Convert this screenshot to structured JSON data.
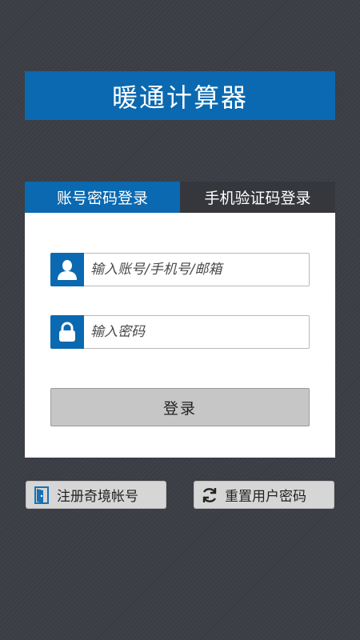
{
  "app": {
    "title": "暖通计算器"
  },
  "tabs": [
    {
      "label": "账号密码登录",
      "active": true
    },
    {
      "label": "手机验证码登录",
      "active": false
    }
  ],
  "login_form": {
    "account_placeholder": "输入账号/手机号/邮箱",
    "account_value": "",
    "password_placeholder": "输入密码",
    "password_value": "",
    "login_label": "登录"
  },
  "links": {
    "register_label": "注册奇境帐号",
    "reset_label": "重置用户密码"
  },
  "icons": {
    "account": "user-icon",
    "password": "lock-icon",
    "register": "door-icon",
    "reset": "refresh-icon"
  },
  "colors": {
    "accent": "#0a69b0",
    "inactive_tab": "#35373c",
    "background": "#3a3d44",
    "button": "#c6c6c6"
  }
}
